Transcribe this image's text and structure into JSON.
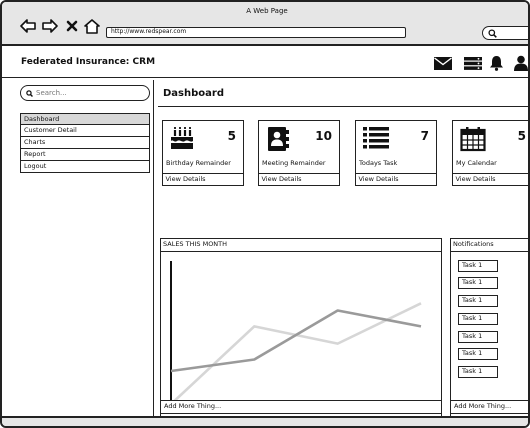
{
  "window": {
    "title": "A Web Page",
    "url": "http://www.redspear.com"
  },
  "app": {
    "title": "Federated Insurance: CRM"
  },
  "sidebar": {
    "search_placeholder": "Search...",
    "items": [
      {
        "label": "Dashboard"
      },
      {
        "label": "Customer Detail"
      },
      {
        "label": "Charts"
      },
      {
        "label": "Report"
      },
      {
        "label": "Logout"
      }
    ]
  },
  "main": {
    "title": "Dashboard",
    "cards": [
      {
        "icon": "birthday-cake-icon",
        "count": "5",
        "label": "Birthday Remainder",
        "action": "View Details"
      },
      {
        "icon": "contact-book-icon",
        "count": "10",
        "label": "Meeting Remainder",
        "action": "View Details"
      },
      {
        "icon": "list-icon",
        "count": "7",
        "label": "Todays Task",
        "action": "View Details"
      },
      {
        "icon": "calendar-icon",
        "count": "5",
        "label": "My Calendar",
        "action": "View Details"
      }
    ],
    "sales_title": "SALES THIS MONTH",
    "notifications_title": "Notifications",
    "tasks": [
      "Task 1",
      "Task 1",
      "Task 1",
      "Task 1",
      "Task 1",
      "Task 1",
      "Task 1"
    ],
    "add_more_left": "Add More Thing...",
    "add_more_right": "Add More Thing..."
  },
  "chart_data": {
    "type": "line",
    "title": "SALES THIS MONTH",
    "x": [
      1,
      2,
      3,
      4
    ],
    "series": [
      {
        "values": [
          2.5,
          3.3,
          6.7,
          5.6
        ],
        "color": "#9a9a9a"
      },
      {
        "values": [
          0.2,
          5.6,
          4.4,
          7.2
        ],
        "color": "#d6d6d6"
      }
    ],
    "ylim": [
      0,
      10
    ],
    "grid": false
  },
  "colors": {
    "chrome": "#e6e6e6",
    "selected": "#d8d8d8",
    "line": "#222222"
  }
}
